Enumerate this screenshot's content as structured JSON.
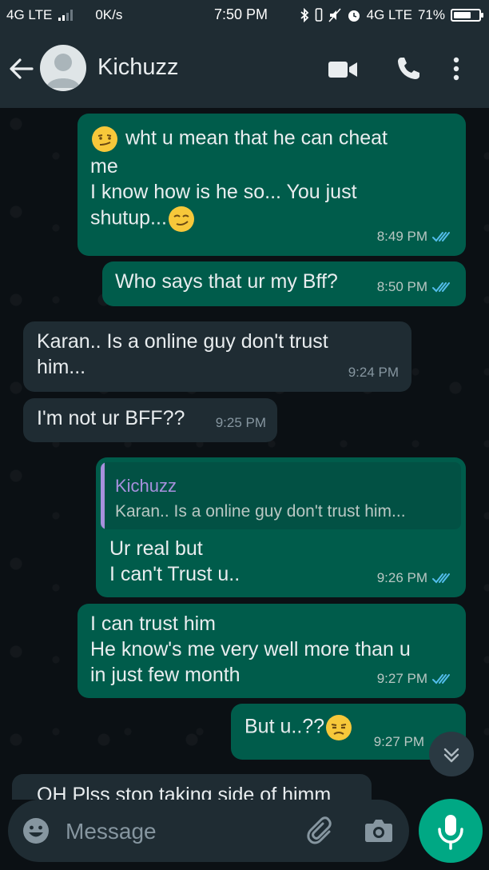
{
  "status_bar": {
    "network_left": "4G LTE",
    "data_speed": "0K/s",
    "time": "7:50 PM",
    "network_right": "4G LTE",
    "battery": "71%",
    "battery_level": 0.71
  },
  "header": {
    "contact_name": "Kichuzz",
    "icons": [
      "back-arrow-icon",
      "avatar",
      "video-call-icon",
      "voice-call-icon",
      "more-options-icon"
    ]
  },
  "messages": [
    {
      "direction": "out",
      "lines": [
        "wht u mean that he can cheat",
        "me",
        "I know how is he so... You just",
        "shutup..."
      ],
      "emojis": [
        "smirk",
        "smirk"
      ],
      "time": "8:49 PM",
      "status": "read"
    },
    {
      "direction": "out",
      "lines": [
        "Who says that ur my Bff?"
      ],
      "time": "8:50 PM",
      "status": "read"
    },
    {
      "direction": "in",
      "lines": [
        "Karan.. Is a online guy don't trust",
        "him..."
      ],
      "time": "9:24 PM"
    },
    {
      "direction": "in",
      "lines": [
        "I'm not ur BFF??"
      ],
      "time": "9:25 PM"
    },
    {
      "direction": "out",
      "quote": {
        "name": "Kichuzz",
        "text": "Karan.. Is a online guy don't trust him..."
      },
      "lines": [
        "Ur real but",
        "I can't Trust u.."
      ],
      "time": "9:26 PM",
      "status": "read"
    },
    {
      "direction": "out",
      "lines": [
        "I can trust him",
        "He know's me very well more than u",
        "in just few month"
      ],
      "time": "9:27 PM",
      "status": "read"
    },
    {
      "direction": "out",
      "lines": [
        "But u..??"
      ],
      "emojis": [
        "unamused"
      ],
      "time": "9:27 PM"
    },
    {
      "direction": "in",
      "lines": [
        "OH Plss stop taking side of himm"
      ],
      "partial": true
    }
  ],
  "composer": {
    "placeholder": "Message"
  },
  "colors": {
    "header_bg": "#1f2c33",
    "chat_bg": "#0b1014",
    "outgoing_bubble": "#005c4b",
    "incoming_bubble": "#1f2c33",
    "accent": "#00a884",
    "read_ticks": "#53bdeb",
    "quote_name": "#a790dd"
  }
}
